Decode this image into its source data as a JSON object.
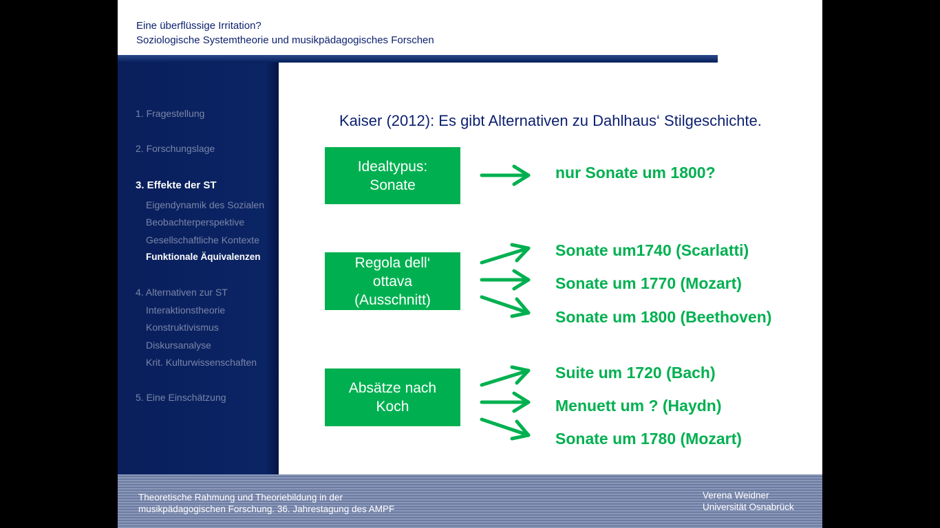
{
  "header": {
    "title_line1": "Eine überflüssige Irritation?",
    "title_line2": "Soziologische Systemtheorie und musikpädagogisches Forschen"
  },
  "sidebar": {
    "items": [
      "1.    Fragestellung",
      "2. Forschungslage",
      "3. Effekte der ST",
      "Eigendynamik des Sozialen",
      "Beobachterperspektive",
      "Gesellschaftliche Kontexte",
      "Funktionale Äquivalenzen",
      "4. Alternativen zur ST",
      "Interaktionstheorie",
      "Konstruktivismus",
      "Diskursanalyse",
      "Krit. Kulturwissenschaften",
      "5. Eine Einschätzung"
    ]
  },
  "main": {
    "heading": "Kaiser (2012): Es gibt Alternativen zu Dahlhaus‘ Stilgeschichte.",
    "boxes": [
      {
        "lines": [
          "Idealtypus:",
          "Sonate"
        ]
      },
      {
        "lines": [
          "Regola dell‘",
          "ottava",
          "(Ausschnitt)"
        ]
      },
      {
        "lines": [
          "Absätze nach",
          "Koch"
        ]
      }
    ],
    "results": [
      "nur Sonate um 1800?",
      "Sonate um1740 (Scarlatti)",
      "Sonate um 1770 (Mozart)",
      "Sonate um 1800 (Beethoven)",
      "Suite um 1720 (Bach)",
      "Menuett um ? (Haydn)",
      "Sonate um 1780 (Mozart)"
    ]
  },
  "footer": {
    "left_line1": "Theoretische Rahmung und Theoriebildung in der",
    "left_line2": "musikpädagogischen Forschung. 36. Jahrestagung des AMPF",
    "right_line1": "Verena Weidner",
    "right_line2": "Universität  Osnabrück"
  },
  "colors": {
    "accent_green": "#00b050",
    "navy": "#0b1f6e"
  }
}
